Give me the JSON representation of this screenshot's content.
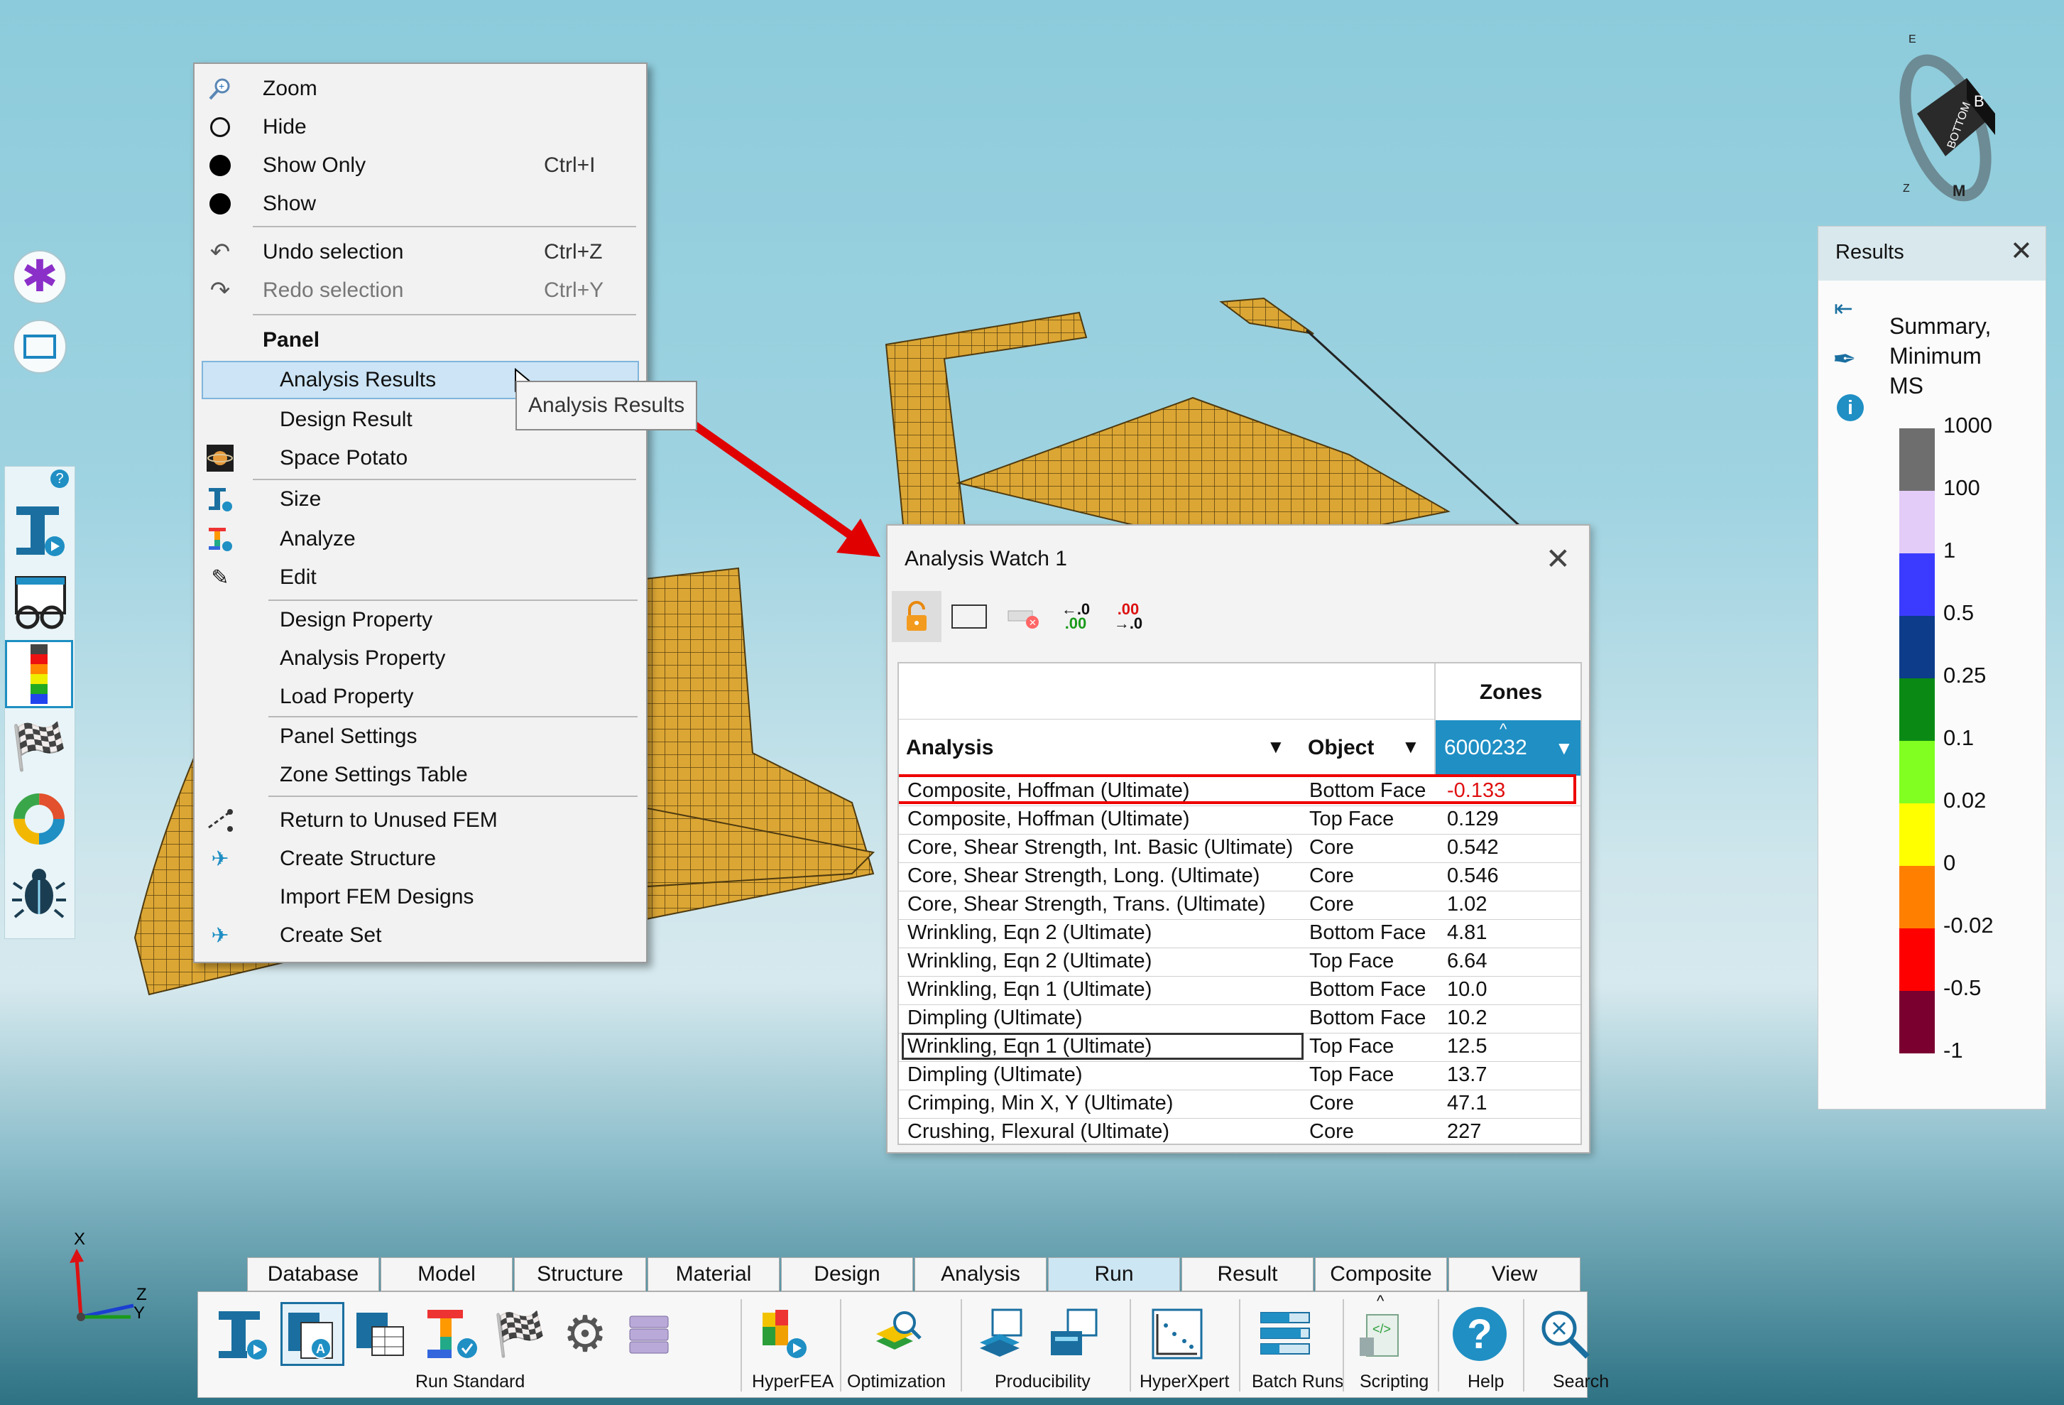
{
  "context_menu": {
    "items": [
      {
        "label": "Zoom",
        "shortcut": ""
      },
      {
        "label": "Hide",
        "shortcut": ""
      },
      {
        "label": "Show Only",
        "shortcut": "Ctrl+I"
      },
      {
        "label": "Show",
        "shortcut": ""
      },
      {
        "label": "Undo selection",
        "shortcut": "Ctrl+Z"
      },
      {
        "label": "Redo selection",
        "shortcut": "Ctrl+Y"
      },
      {
        "label": "Panel",
        "shortcut": ""
      },
      {
        "label": "Analysis Results",
        "shortcut": ""
      },
      {
        "label": "Design Result",
        "shortcut": ""
      },
      {
        "label": "Space Potato",
        "shortcut": ""
      },
      {
        "label": "Size",
        "shortcut": ""
      },
      {
        "label": "Analyze",
        "shortcut": ""
      },
      {
        "label": "Edit",
        "shortcut": ""
      },
      {
        "label": "Design Property",
        "shortcut": ""
      },
      {
        "label": "Analysis Property",
        "shortcut": ""
      },
      {
        "label": "Load Property",
        "shortcut": ""
      },
      {
        "label": "Panel Settings",
        "shortcut": ""
      },
      {
        "label": "Zone Settings Table",
        "shortcut": ""
      },
      {
        "label": "Return to Unused FEM",
        "shortcut": ""
      },
      {
        "label": "Create Structure",
        "shortcut": ""
      },
      {
        "label": "Import FEM Designs",
        "shortcut": ""
      },
      {
        "label": "Create Set",
        "shortcut": ""
      }
    ],
    "tooltip": "Analysis Results"
  },
  "watch": {
    "title": "Analysis Watch 1",
    "zones_header": "Zones",
    "zone_id": "6000232",
    "col_analysis": "Analysis",
    "col_object": "Object",
    "rows": [
      {
        "analysis": "Composite, Hoffman (Ultimate)",
        "object": "Bottom Face",
        "value": "-0.133"
      },
      {
        "analysis": "Composite, Hoffman (Ultimate)",
        "object": "Top Face",
        "value": "0.129"
      },
      {
        "analysis": "Core, Shear Strength, Int. Basic (Ultimate)",
        "object": "Core",
        "value": "0.542"
      },
      {
        "analysis": "Core, Shear Strength, Long. (Ultimate)",
        "object": "Core",
        "value": "0.546"
      },
      {
        "analysis": "Core, Shear Strength, Trans. (Ultimate)",
        "object": "Core",
        "value": "1.02"
      },
      {
        "analysis": "Wrinkling, Eqn 2 (Ultimate)",
        "object": "Bottom Face",
        "value": "4.81"
      },
      {
        "analysis": "Wrinkling, Eqn 2 (Ultimate)",
        "object": "Top Face",
        "value": "6.64"
      },
      {
        "analysis": "Wrinkling, Eqn 1 (Ultimate)",
        "object": "Bottom Face",
        "value": "10.0"
      },
      {
        "analysis": "Dimpling (Ultimate)",
        "object": "Bottom Face",
        "value": "10.2"
      },
      {
        "analysis": "Wrinkling, Eqn 1 (Ultimate)",
        "object": "Top Face",
        "value": "12.5"
      },
      {
        "analysis": "Dimpling (Ultimate)",
        "object": "Top Face",
        "value": "13.7"
      },
      {
        "analysis": "Crimping, Min X, Y (Ultimate)",
        "object": "Core",
        "value": "47.1"
      },
      {
        "analysis": "Crushing, Flexural (Ultimate)",
        "object": "Core",
        "value": "227"
      }
    ],
    "negative_color": "#e01010"
  },
  "results_panel": {
    "title": "Results",
    "summary": [
      "Summary,",
      "Minimum",
      "MS"
    ],
    "legend": [
      {
        "label": "1000",
        "color": "#6e6e6e"
      },
      {
        "label": "100",
        "color": "#e3ccf7"
      },
      {
        "label": "1",
        "color": "#3b3bff"
      },
      {
        "label": "0.5",
        "color": "#0d3c8a"
      },
      {
        "label": "0.25",
        "color": "#0a8a14"
      },
      {
        "label": "0.1",
        "color": "#80ff20"
      },
      {
        "label": "0.02",
        "color": "#ffff00"
      },
      {
        "label": "0",
        "color": "#ff8000"
      },
      {
        "label": "-0.02",
        "color": "#ff0000"
      },
      {
        "label": "-0.5",
        "color": "#7a0030"
      },
      {
        "label": "-1",
        "color": ""
      }
    ]
  },
  "ribbon": {
    "tabs": [
      "Database",
      "Model",
      "Structure",
      "Material",
      "Design",
      "Analysis",
      "Run",
      "Result",
      "Composite",
      "View"
    ],
    "selected_tab": "Run",
    "groups": [
      "Run Standard",
      "HyperFEA",
      "Optimization",
      "Producibility",
      "HyperXpert",
      "Batch Runs",
      "Scripting",
      "Help",
      "Search"
    ]
  },
  "triad": {
    "x": "X",
    "y": "Y",
    "z": "Z"
  },
  "viewcube": {
    "face": "BOTTOM"
  },
  "accent_color": "#1f8fc4"
}
